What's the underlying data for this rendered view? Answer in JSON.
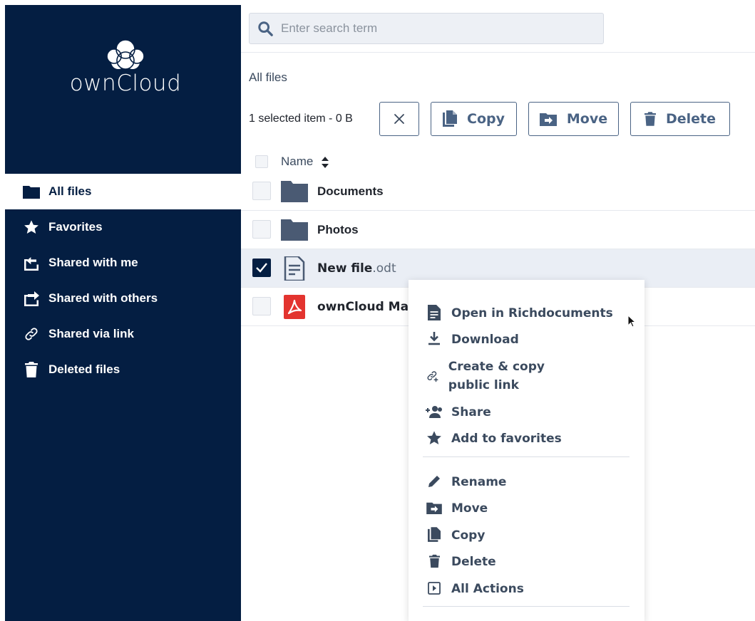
{
  "app": {
    "logo_text": "ownCloud"
  },
  "sidebar": {
    "items": [
      {
        "label": "All files",
        "icon": "folder-icon",
        "active": true
      },
      {
        "label": "Favorites",
        "icon": "star-icon"
      },
      {
        "label": "Shared with me",
        "icon": "share-in-icon"
      },
      {
        "label": "Shared with others",
        "icon": "share-out-icon"
      },
      {
        "label": "Shared via link",
        "icon": "link-icon"
      },
      {
        "label": "Deleted files",
        "icon": "trash-icon"
      }
    ]
  },
  "search": {
    "placeholder": "Enter search term",
    "value": ""
  },
  "breadcrumb": "All files",
  "toolbar": {
    "selection_info": "1 selected item - 0 B",
    "copy_label": "Copy",
    "move_label": "Move",
    "delete_label": "Delete"
  },
  "table": {
    "header_name": "Name",
    "rows": [
      {
        "name": "Documents",
        "ext": "",
        "type": "folder",
        "selected": false
      },
      {
        "name": "Photos",
        "ext": "",
        "type": "folder",
        "selected": false
      },
      {
        "name": "New file",
        "ext": ".odt",
        "type": "document",
        "selected": true
      },
      {
        "name": "ownCloud Ma",
        "ext": "",
        "type": "pdf",
        "selected": false
      }
    ]
  },
  "context_menu": {
    "items": [
      {
        "label": "Open in Richdocuments",
        "icon": "document-icon"
      },
      {
        "label": "Download",
        "icon": "download-icon"
      },
      {
        "label": "Create & copy public link",
        "icon": "link-add-icon"
      },
      {
        "label": "Share",
        "icon": "user-add-icon"
      },
      {
        "label": "Add to favorites",
        "icon": "star-icon"
      },
      {
        "label": "Rename",
        "icon": "pencil-icon"
      },
      {
        "label": "Move",
        "icon": "folder-move-icon"
      },
      {
        "label": "Copy",
        "icon": "copy-icon"
      },
      {
        "label": "Delete",
        "icon": "trash-icon"
      },
      {
        "label": "All Actions",
        "icon": "actions-icon"
      }
    ]
  },
  "colors": {
    "sidebar_bg": "#041e42",
    "accent": "#4a6384",
    "folder": "#4a5a73",
    "pdf": "#e3342f"
  }
}
